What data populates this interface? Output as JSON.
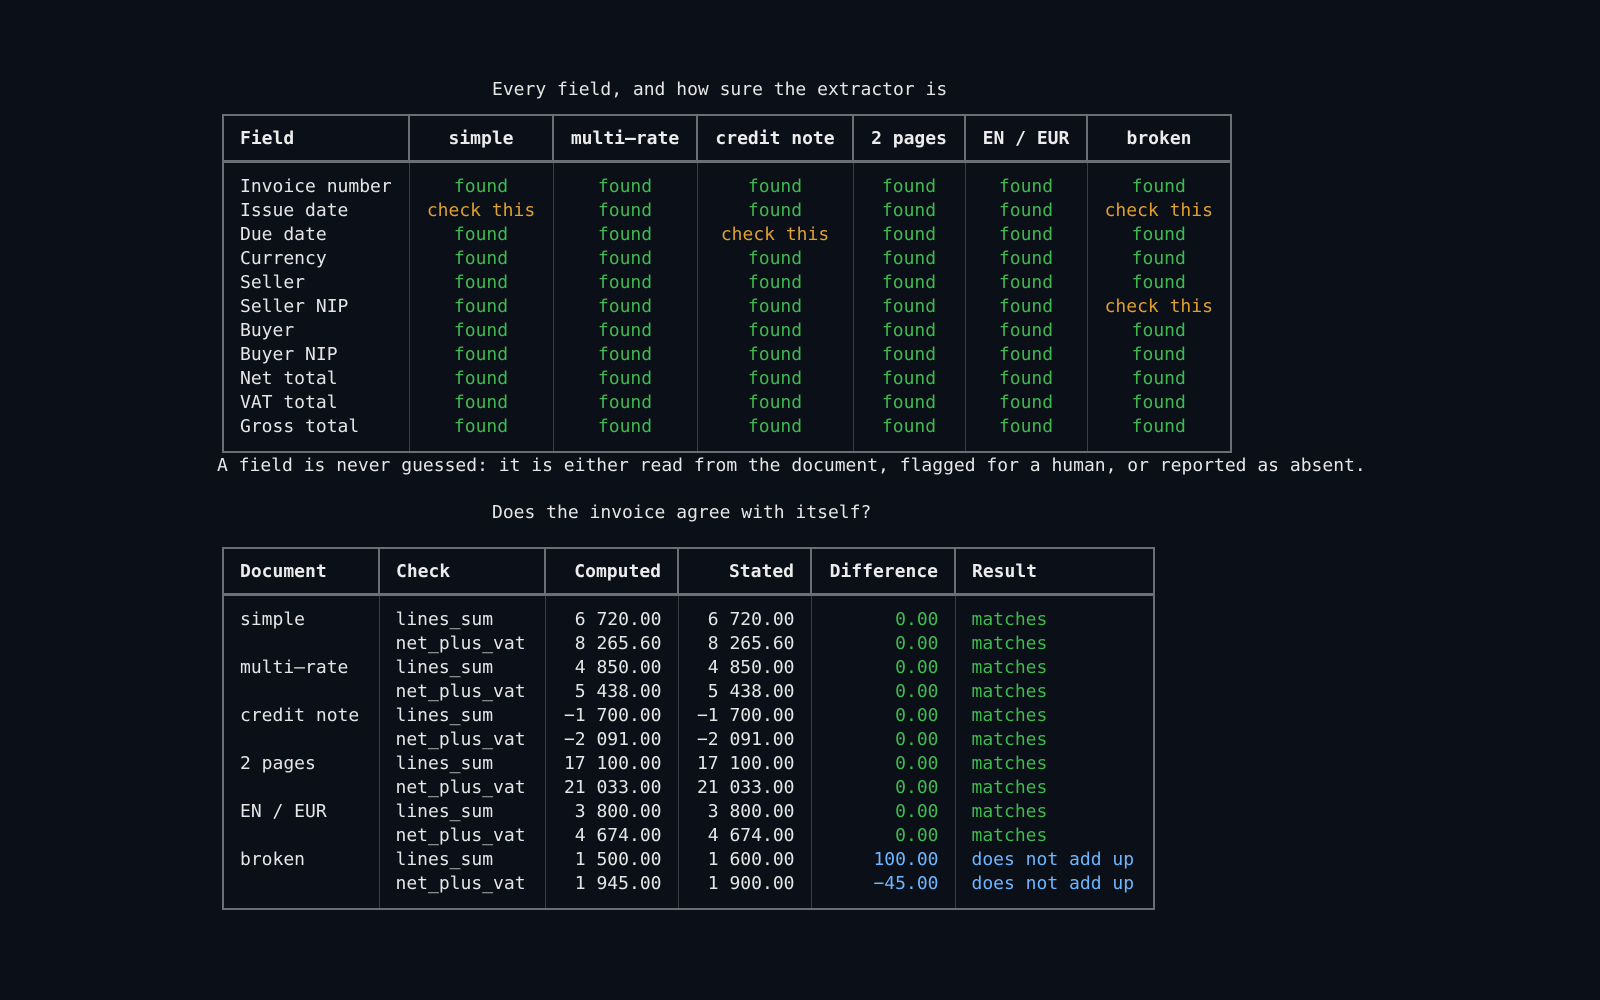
{
  "fields_section": {
    "title": "Every field, and how sure the extractor is",
    "columns": [
      "Field",
      "simple",
      "multi–rate",
      "credit note",
      "2 pages",
      "EN / EUR",
      "broken"
    ],
    "rows": [
      {
        "field": "Invoice number",
        "values": [
          "found",
          "found",
          "found",
          "found",
          "found",
          "found"
        ]
      },
      {
        "field": "Issue date",
        "values": [
          "check this",
          "found",
          "found",
          "found",
          "found",
          "check this"
        ]
      },
      {
        "field": "Due date",
        "values": [
          "found",
          "found",
          "check this",
          "found",
          "found",
          "found"
        ]
      },
      {
        "field": "Currency",
        "values": [
          "found",
          "found",
          "found",
          "found",
          "found",
          "found"
        ]
      },
      {
        "field": "Seller",
        "values": [
          "found",
          "found",
          "found",
          "found",
          "found",
          "found"
        ]
      },
      {
        "field": "Seller NIP",
        "values": [
          "found",
          "found",
          "found",
          "found",
          "found",
          "check this"
        ]
      },
      {
        "field": "Buyer",
        "values": [
          "found",
          "found",
          "found",
          "found",
          "found",
          "found"
        ]
      },
      {
        "field": "Buyer NIP",
        "values": [
          "found",
          "found",
          "found",
          "found",
          "found",
          "found"
        ]
      },
      {
        "field": "Net total",
        "values": [
          "found",
          "found",
          "found",
          "found",
          "found",
          "found"
        ]
      },
      {
        "field": "VAT total",
        "values": [
          "found",
          "found",
          "found",
          "found",
          "found",
          "found"
        ]
      },
      {
        "field": "Gross total",
        "values": [
          "found",
          "found",
          "found",
          "found",
          "found",
          "found"
        ]
      }
    ],
    "note": "A field is never guessed: it is either read from the document, flagged for a human, or reported as absent."
  },
  "checks_section": {
    "title": "Does the invoice agree with itself?",
    "columns": [
      "Document",
      "Check",
      "Computed",
      "Stated",
      "Difference",
      "Result"
    ],
    "rows": [
      {
        "document": "simple",
        "check": "lines_sum",
        "computed": "6 720.00",
        "stated": "6 720.00",
        "difference": "0.00",
        "result": "matches"
      },
      {
        "document": "",
        "check": "net_plus_vat",
        "computed": "8 265.60",
        "stated": "8 265.60",
        "difference": "0.00",
        "result": "matches"
      },
      {
        "document": "multi–rate",
        "check": "lines_sum",
        "computed": "4 850.00",
        "stated": "4 850.00",
        "difference": "0.00",
        "result": "matches"
      },
      {
        "document": "",
        "check": "net_plus_vat",
        "computed": "5 438.00",
        "stated": "5 438.00",
        "difference": "0.00",
        "result": "matches"
      },
      {
        "document": "credit note",
        "check": "lines_sum",
        "computed": "−1 700.00",
        "stated": "−1 700.00",
        "difference": "0.00",
        "result": "matches"
      },
      {
        "document": "",
        "check": "net_plus_vat",
        "computed": "−2 091.00",
        "stated": "−2 091.00",
        "difference": "0.00",
        "result": "matches"
      },
      {
        "document": "2 pages",
        "check": "lines_sum",
        "computed": "17 100.00",
        "stated": "17 100.00",
        "difference": "0.00",
        "result": "matches"
      },
      {
        "document": "",
        "check": "net_plus_vat",
        "computed": "21 033.00",
        "stated": "21 033.00",
        "difference": "0.00",
        "result": "matches"
      },
      {
        "document": "EN / EUR",
        "check": "lines_sum",
        "computed": "3 800.00",
        "stated": "3 800.00",
        "difference": "0.00",
        "result": "matches"
      },
      {
        "document": "",
        "check": "net_plus_vat",
        "computed": "4 674.00",
        "stated": "4 674.00",
        "difference": "0.00",
        "result": "matches"
      },
      {
        "document": "broken",
        "check": "lines_sum",
        "computed": "1 500.00",
        "stated": "1 600.00",
        "difference": "100.00",
        "result": "does not add up"
      },
      {
        "document": "",
        "check": "net_plus_vat",
        "computed": "1 945.00",
        "stated": "1 900.00",
        "difference": "−45.00",
        "result": "does not add up"
      }
    ]
  },
  "colors": {
    "background": "#0b0f17",
    "found": "#3fb950",
    "check_this": "#e0a030",
    "mismatch": "#6cb6ff",
    "border": "#6b6e75"
  }
}
